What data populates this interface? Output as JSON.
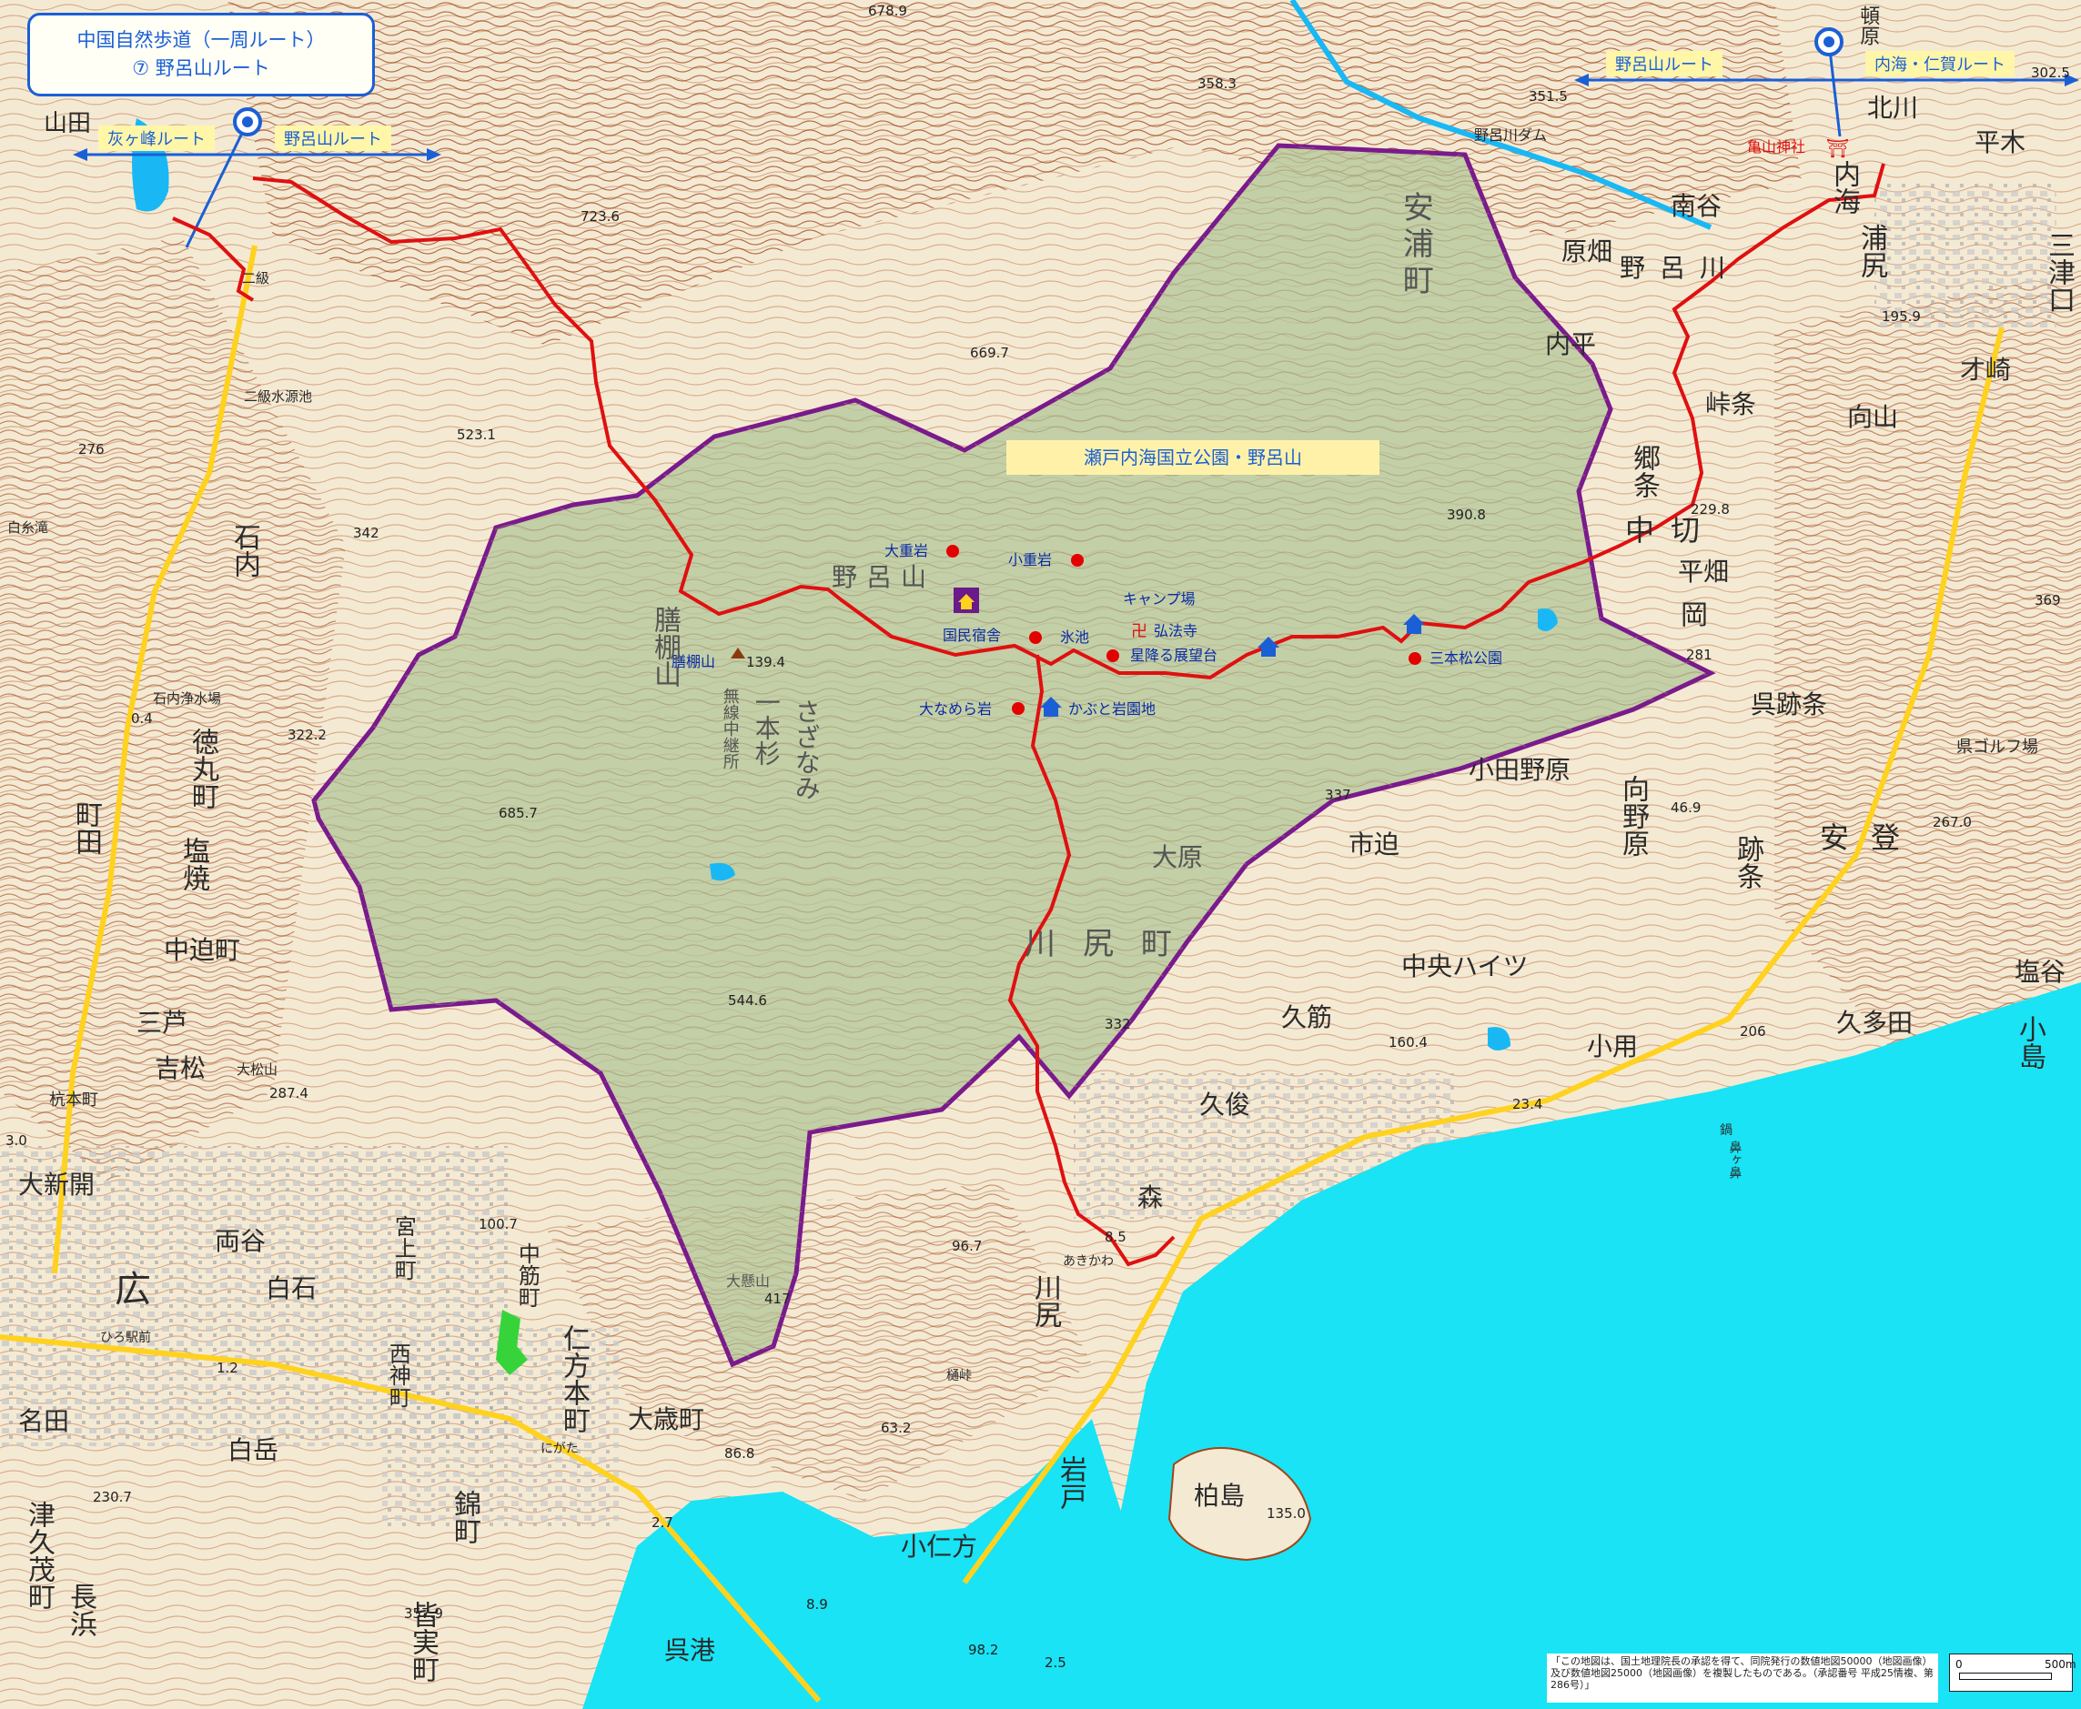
{
  "title": {
    "line1": "中国自然歩道（一周ルート）",
    "line2": "⑦ 野呂山ルート"
  },
  "route_labels": {
    "left_west": "灰ヶ峰ルート",
    "left_east": "野呂山ルート",
    "right_west": "野呂山ルート",
    "right_east": "内海・仁賀ルート"
  },
  "park_name": "瀬戸内海国立公園・野呂山",
  "pois": {
    "oshigeiwa": "大重岩",
    "koshigeiwa": "小重岩",
    "camp": "キャンプ場",
    "kokumin_shukusha": "国民宿舎",
    "hikeike": "氷池",
    "kobo_ji": "弘法寺",
    "hoshifuru": "星降る展望台",
    "sanbonmatsu": "三本松公園",
    "onamera": "大なめら岩",
    "kabuto": "かぶと岩園地",
    "zendanayama": "膳棚山",
    "kameyama": "亀山神社"
  },
  "places": [
    {
      "text": "山田",
      "color": "#2b2b2b"
    },
    {
      "text": "二級水源池",
      "color": "#2b2b2b"
    },
    {
      "text": "石内",
      "color": "#2b2b2b"
    },
    {
      "text": "石内浄水場",
      "color": "#2b2b2b"
    },
    {
      "text": "徳丸町",
      "color": "#2b2b2b"
    },
    {
      "text": "町田",
      "color": "#2b2b2b"
    },
    {
      "text": "塩焼",
      "color": "#2b2b2b"
    },
    {
      "text": "中迫町",
      "color": "#2b2b2b"
    },
    {
      "text": "三芦",
      "color": "#2b2b2b"
    },
    {
      "text": "吉松",
      "color": "#2b2b2b"
    },
    {
      "text": "杭本町",
      "color": "#2b2b2b"
    },
    {
      "text": "大新開",
      "color": "#2b2b2b"
    },
    {
      "text": "両谷",
      "color": "#2b2b2b"
    },
    {
      "text": "広",
      "color": "#2b2b2b"
    },
    {
      "text": "白石",
      "color": "#2b2b2b"
    },
    {
      "text": "宮上町",
      "color": "#2b2b2b"
    },
    {
      "text": "中筋町",
      "color": "#2b2b2b"
    },
    {
      "text": "西神町",
      "color": "#2b2b2b"
    },
    {
      "text": "仁方本町",
      "color": "#2b2b2b"
    },
    {
      "text": "大歳町",
      "color": "#2b2b2b"
    },
    {
      "text": "名田",
      "color": "#2b2b2b"
    },
    {
      "text": "白岳",
      "color": "#2b2b2b"
    },
    {
      "text": "津久茂町",
      "color": "#2b2b2b"
    },
    {
      "text": "長浜",
      "color": "#2b2b2b"
    },
    {
      "text": "錦町",
      "color": "#2b2b2b"
    },
    {
      "text": "皆実町",
      "color": "#2b2b2b"
    },
    {
      "text": "呉港",
      "color": "#2b2b2b"
    },
    {
      "text": "小仁方",
      "color": "#2b2b2b"
    },
    {
      "text": "岩戸",
      "color": "#2b2b2b"
    },
    {
      "text": "柏島",
      "color": "#2b2b2b"
    },
    {
      "text": "川尻",
      "color": "#2b2b2b"
    },
    {
      "text": "森",
      "color": "#2b2b2b"
    },
    {
      "text": "久俊",
      "color": "#2b2b2b"
    },
    {
      "text": "久筋",
      "color": "#2b2b2b"
    },
    {
      "text": "中央ハイツ",
      "color": "#2b2b2b"
    },
    {
      "text": "市迫",
      "color": "#2b2b2b"
    },
    {
      "text": "小田野原",
      "color": "#2b2b2b"
    },
    {
      "text": "向野原",
      "color": "#2b2b2b"
    },
    {
      "text": "跡条",
      "color": "#2b2b2b"
    },
    {
      "text": "安登",
      "color": "#2b2b2b"
    },
    {
      "text": "呉跡条",
      "color": "#2b2b2b"
    },
    {
      "text": "県ゴルフ場",
      "color": "#2b2b2b"
    },
    {
      "text": "小用",
      "color": "#2b2b2b"
    },
    {
      "text": "久多田",
      "color": "#2b2b2b"
    },
    {
      "text": "小島",
      "color": "#2b2b2b"
    },
    {
      "text": "塩谷",
      "color": "#2b2b2b"
    },
    {
      "text": "岡",
      "color": "#2b2b2b"
    },
    {
      "text": "平畑",
      "color": "#2b2b2b"
    },
    {
      "text": "中切",
      "color": "#2b2b2b"
    },
    {
      "text": "郷条",
      "color": "#2b2b2b"
    },
    {
      "text": "峠条",
      "color": "#2b2b2b"
    },
    {
      "text": "向山",
      "color": "#2b2b2b"
    },
    {
      "text": "才崎",
      "color": "#2b2b2b"
    },
    {
      "text": "三津口",
      "color": "#2b2b2b"
    },
    {
      "text": "内平",
      "color": "#2b2b2b"
    },
    {
      "text": "原畑",
      "color": "#2b2b2b"
    },
    {
      "text": "野呂川",
      "color": "#2b2b2b"
    },
    {
      "text": "南谷",
      "color": "#2b2b2b"
    },
    {
      "text": "内海",
      "color": "#2b2b2b"
    },
    {
      "text": "浦尻",
      "color": "#2b2b2b"
    },
    {
      "text": "平木",
      "color": "#2b2b2b"
    },
    {
      "text": "北川",
      "color": "#2b2b2b"
    },
    {
      "text": "頓原",
      "color": "#2b2b2b"
    },
    {
      "text": "野呂川ダム",
      "color": "#2b2b2b"
    },
    {
      "text": "安浦町",
      "color": "#555555"
    },
    {
      "text": "川尻町",
      "color": "#555555"
    },
    {
      "text": "大原",
      "color": "#555555"
    },
    {
      "text": "野呂山",
      "color": "#555555"
    },
    {
      "text": "膳棚山",
      "color": "#555555"
    },
    {
      "text": "一本杉",
      "color": "#555555"
    },
    {
      "text": "無線中継所",
      "color": "#555555"
    },
    {
      "text": "さざなみ",
      "color": "#555555"
    },
    {
      "text": "大懸山",
      "color": "#555555"
    },
    {
      "text": "白糸滝",
      "color": "#2b2b2b"
    },
    {
      "text": "樋峠",
      "color": "#2b2b2b"
    },
    {
      "text": "鼻ヶ鼻",
      "color": "#2b2b2b"
    },
    {
      "text": "大松山",
      "color": "#2b2b2b"
    },
    {
      "text": "二級",
      "color": "#2b2b2b"
    },
    {
      "text": "ひろ駅前",
      "color": "#2b2b2b"
    },
    {
      "text": "にがた",
      "color": "#2b2b2b"
    },
    {
      "text": "あきかわ",
      "color": "#2b2b2b"
    },
    {
      "text": "鍋",
      "color": "#2b2b2b"
    }
  ],
  "elevations": [
    "678.9",
    "723.6",
    "669.7",
    "523.1",
    "358.3",
    "351.5",
    "302.5",
    "195.9",
    "390.8",
    "229.8",
    "281",
    "276",
    "342",
    "322.2",
    "139.4",
    "685.7",
    "287.4",
    "544.6",
    "332",
    "417",
    "160.4",
    "206",
    "337",
    "46.9",
    "369",
    "267.0",
    "23.4",
    "8.5",
    "96.7",
    "100.7",
    "86.8",
    "63.2",
    "135.0",
    "357.9",
    "230.7",
    "98.2",
    "8.9",
    "2.5",
    "2.7",
    "3.0",
    "0.4",
    "1.2"
  ],
  "credit": "「この地図は、国土地理院長の承認を得て、同院発行の数値地図50000（地図画像）及び数値地図25000（地図画像）を複製したものである。（承認番号 平成25情複、第286号）」",
  "scale": {
    "zero": "0",
    "label": "500m"
  },
  "colors": {
    "sea": "#19e3f5",
    "park": "#b5c79a",
    "boundary": "#7a1a8c",
    "route": "#e01010",
    "contour": "#b35a2a",
    "road": "#ffd21f",
    "blue_route": "#1b5fd6"
  }
}
